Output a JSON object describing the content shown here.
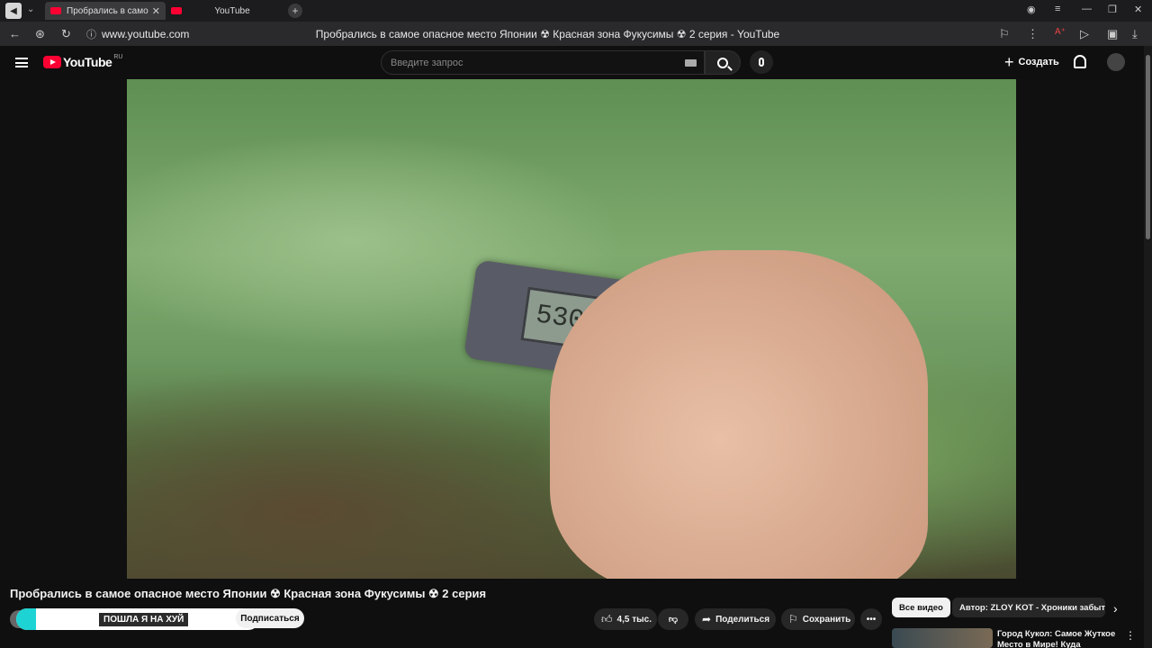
{
  "browser": {
    "tabs": [
      {
        "title": "Пробрались в самое опасное место Японии"
      },
      {
        "title": "YouTube"
      }
    ],
    "url": "www.youtube.com",
    "page_title": "Пробрались в самое опасное место Японии ☢ Красная зона Фукусимы ☢ 2 серия - YouTube"
  },
  "youtube": {
    "logo": "YouTube",
    "region": "RU",
    "search_placeholder": "Введите запрос",
    "create_label": "Создать"
  },
  "video": {
    "title": "Пробрались в самое опасное место Японии ☢ Красная зона Фукусимы ☢ 2 серия",
    "dosimeter_reading": "530",
    "overlay_badge": "ПОШЛА Я НА ХУЙ",
    "subscribe_label": "Подписаться",
    "likes": "4,5 тыс.",
    "share_label": "Поделиться",
    "save_label": "Сохранить"
  },
  "sidebar": {
    "chips": [
      "Все видео",
      "Автор: ZLOY KOT - Хроники забытого"
    ],
    "recommendation_title": "Город Кукол: Самое Жуткое Место в Мире! Куда Пропали"
  },
  "colors": {
    "accent": "#ff0033",
    "bg": "#0f0f0f"
  }
}
